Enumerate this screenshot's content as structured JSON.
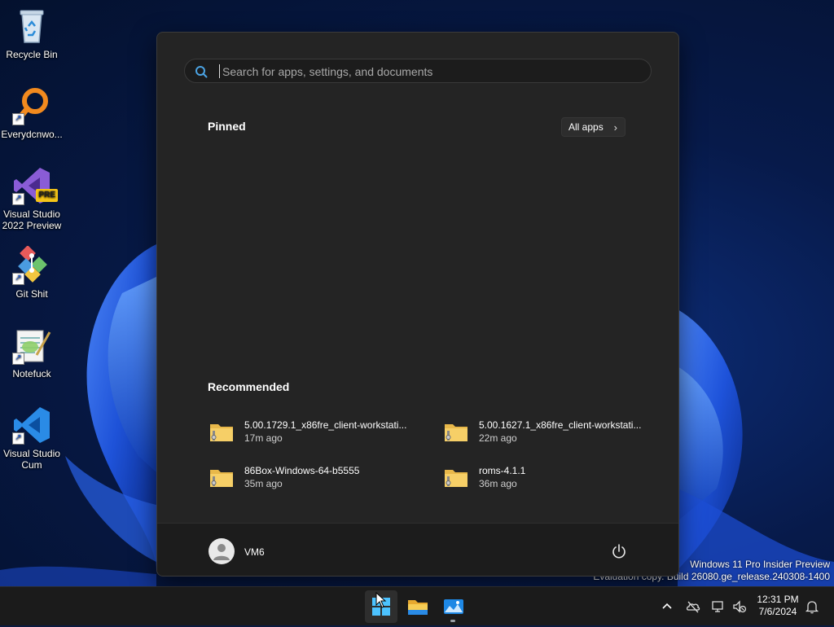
{
  "desktop": {
    "icons": [
      {
        "label": "Recycle Bin",
        "icon": "recycle-bin-icon"
      },
      {
        "label": "Everydcnwo...",
        "icon": "magnifier-app-icon"
      },
      {
        "label": "Visual Studio 2022 Preview",
        "icon": "visual-studio-preview-icon"
      },
      {
        "label": "Git Shit",
        "icon": "git-icon"
      },
      {
        "label": "Notefuck",
        "icon": "notepad-icon"
      },
      {
        "label": "Visual Studio Cum",
        "icon": "vscode-icon"
      }
    ],
    "vs_badge": "PRE"
  },
  "start_menu": {
    "search_placeholder": "Search for apps, settings, and documents",
    "pinned_title": "Pinned",
    "all_apps_label": "All apps",
    "recommended_title": "Recommended",
    "recommended": [
      {
        "name": "5.00.1729.1_x86fre_client-workstati...",
        "time": "17m ago"
      },
      {
        "name": "5.00.1627.1_x86fre_client-workstati...",
        "time": "22m ago"
      },
      {
        "name": "86Box-Windows-64-b5555",
        "time": "35m ago"
      },
      {
        "name": "roms-4.1.1",
        "time": "36m ago"
      }
    ],
    "user_name": "VM6"
  },
  "watermark": {
    "line1": "Windows 11 Pro Insider Preview",
    "line2": "Evaluation copy. Build 26080.ge_release.240308-1400"
  },
  "taskbar": {
    "apps": [
      "start-icon",
      "file-explorer-icon",
      "photos-icon"
    ],
    "time": "12:31 PM",
    "date": "7/6/2024"
  },
  "colors": {
    "accent": "#0067c0",
    "start_bg": "#242424",
    "taskbar_bg": "#1b1b1b"
  }
}
